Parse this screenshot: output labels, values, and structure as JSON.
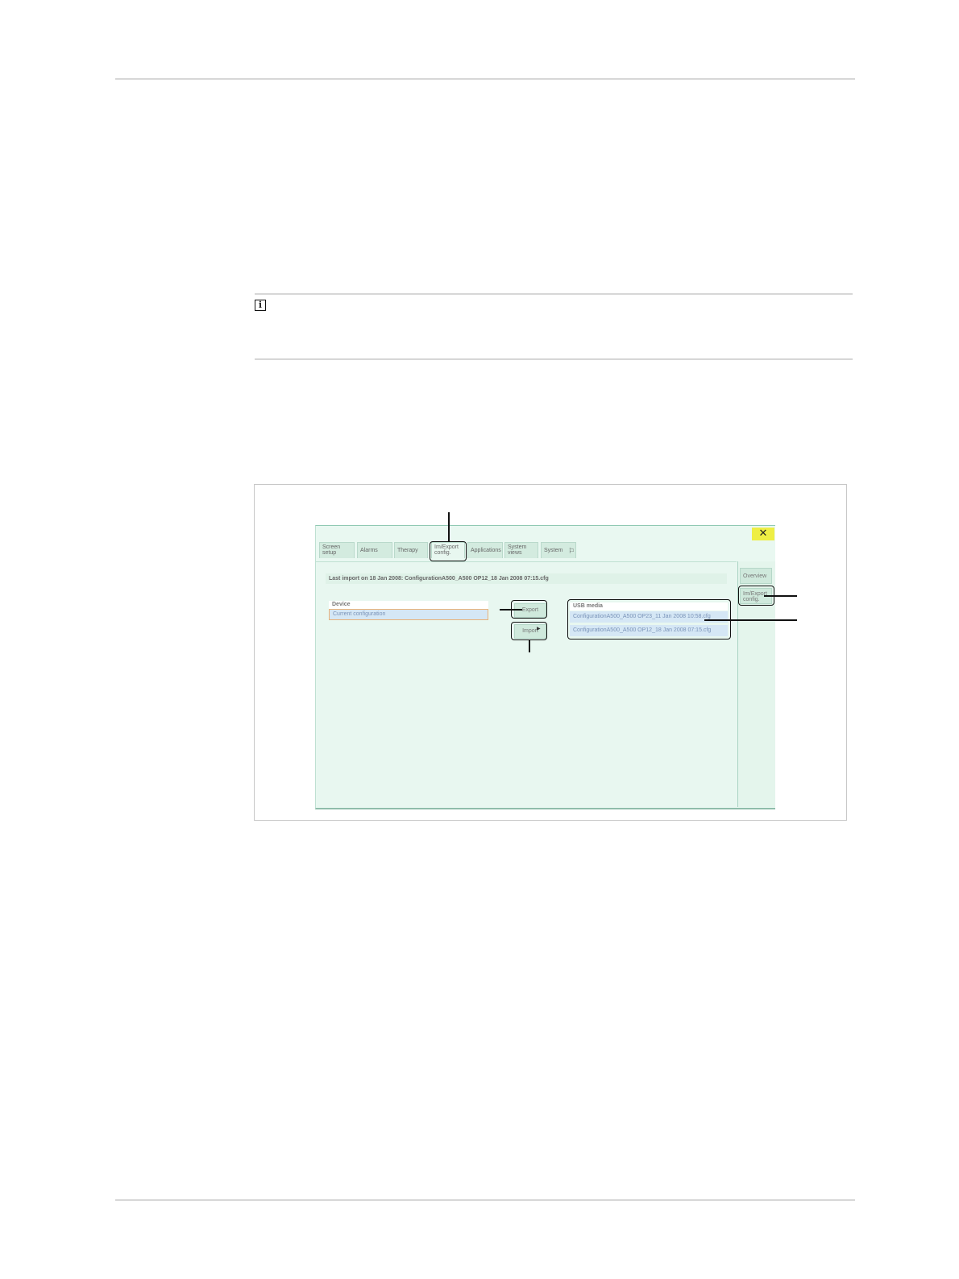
{
  "device_screen": {
    "close_glyph": "✕",
    "tabs": [
      {
        "label": "Screen setup"
      },
      {
        "label": "Alarms"
      },
      {
        "label": "Therapy"
      },
      {
        "label": "Im/Export config."
      },
      {
        "label": "Applications"
      },
      {
        "label": "System views"
      },
      {
        "label": "System"
      }
    ],
    "side_buttons": [
      {
        "label": "Overview"
      },
      {
        "label": "Im/Export config."
      }
    ],
    "last_import": "Last import on 18 Jan 2008:   ConfigurationA500_A500 OP12_18 Jan 2008 07:15.cfg",
    "device_list": {
      "header": "Device",
      "items": [
        "Current configuration"
      ]
    },
    "export_button": "Export",
    "import_button": "Import",
    "usb_list": {
      "header": "USB media",
      "items": [
        "ConfigurationA500_A500 OP23_11 Jan 2008 10:58.cfg",
        "ConfigurationA500_A500 OP12_18 Jan 2008 07:15.cfg"
      ]
    }
  }
}
